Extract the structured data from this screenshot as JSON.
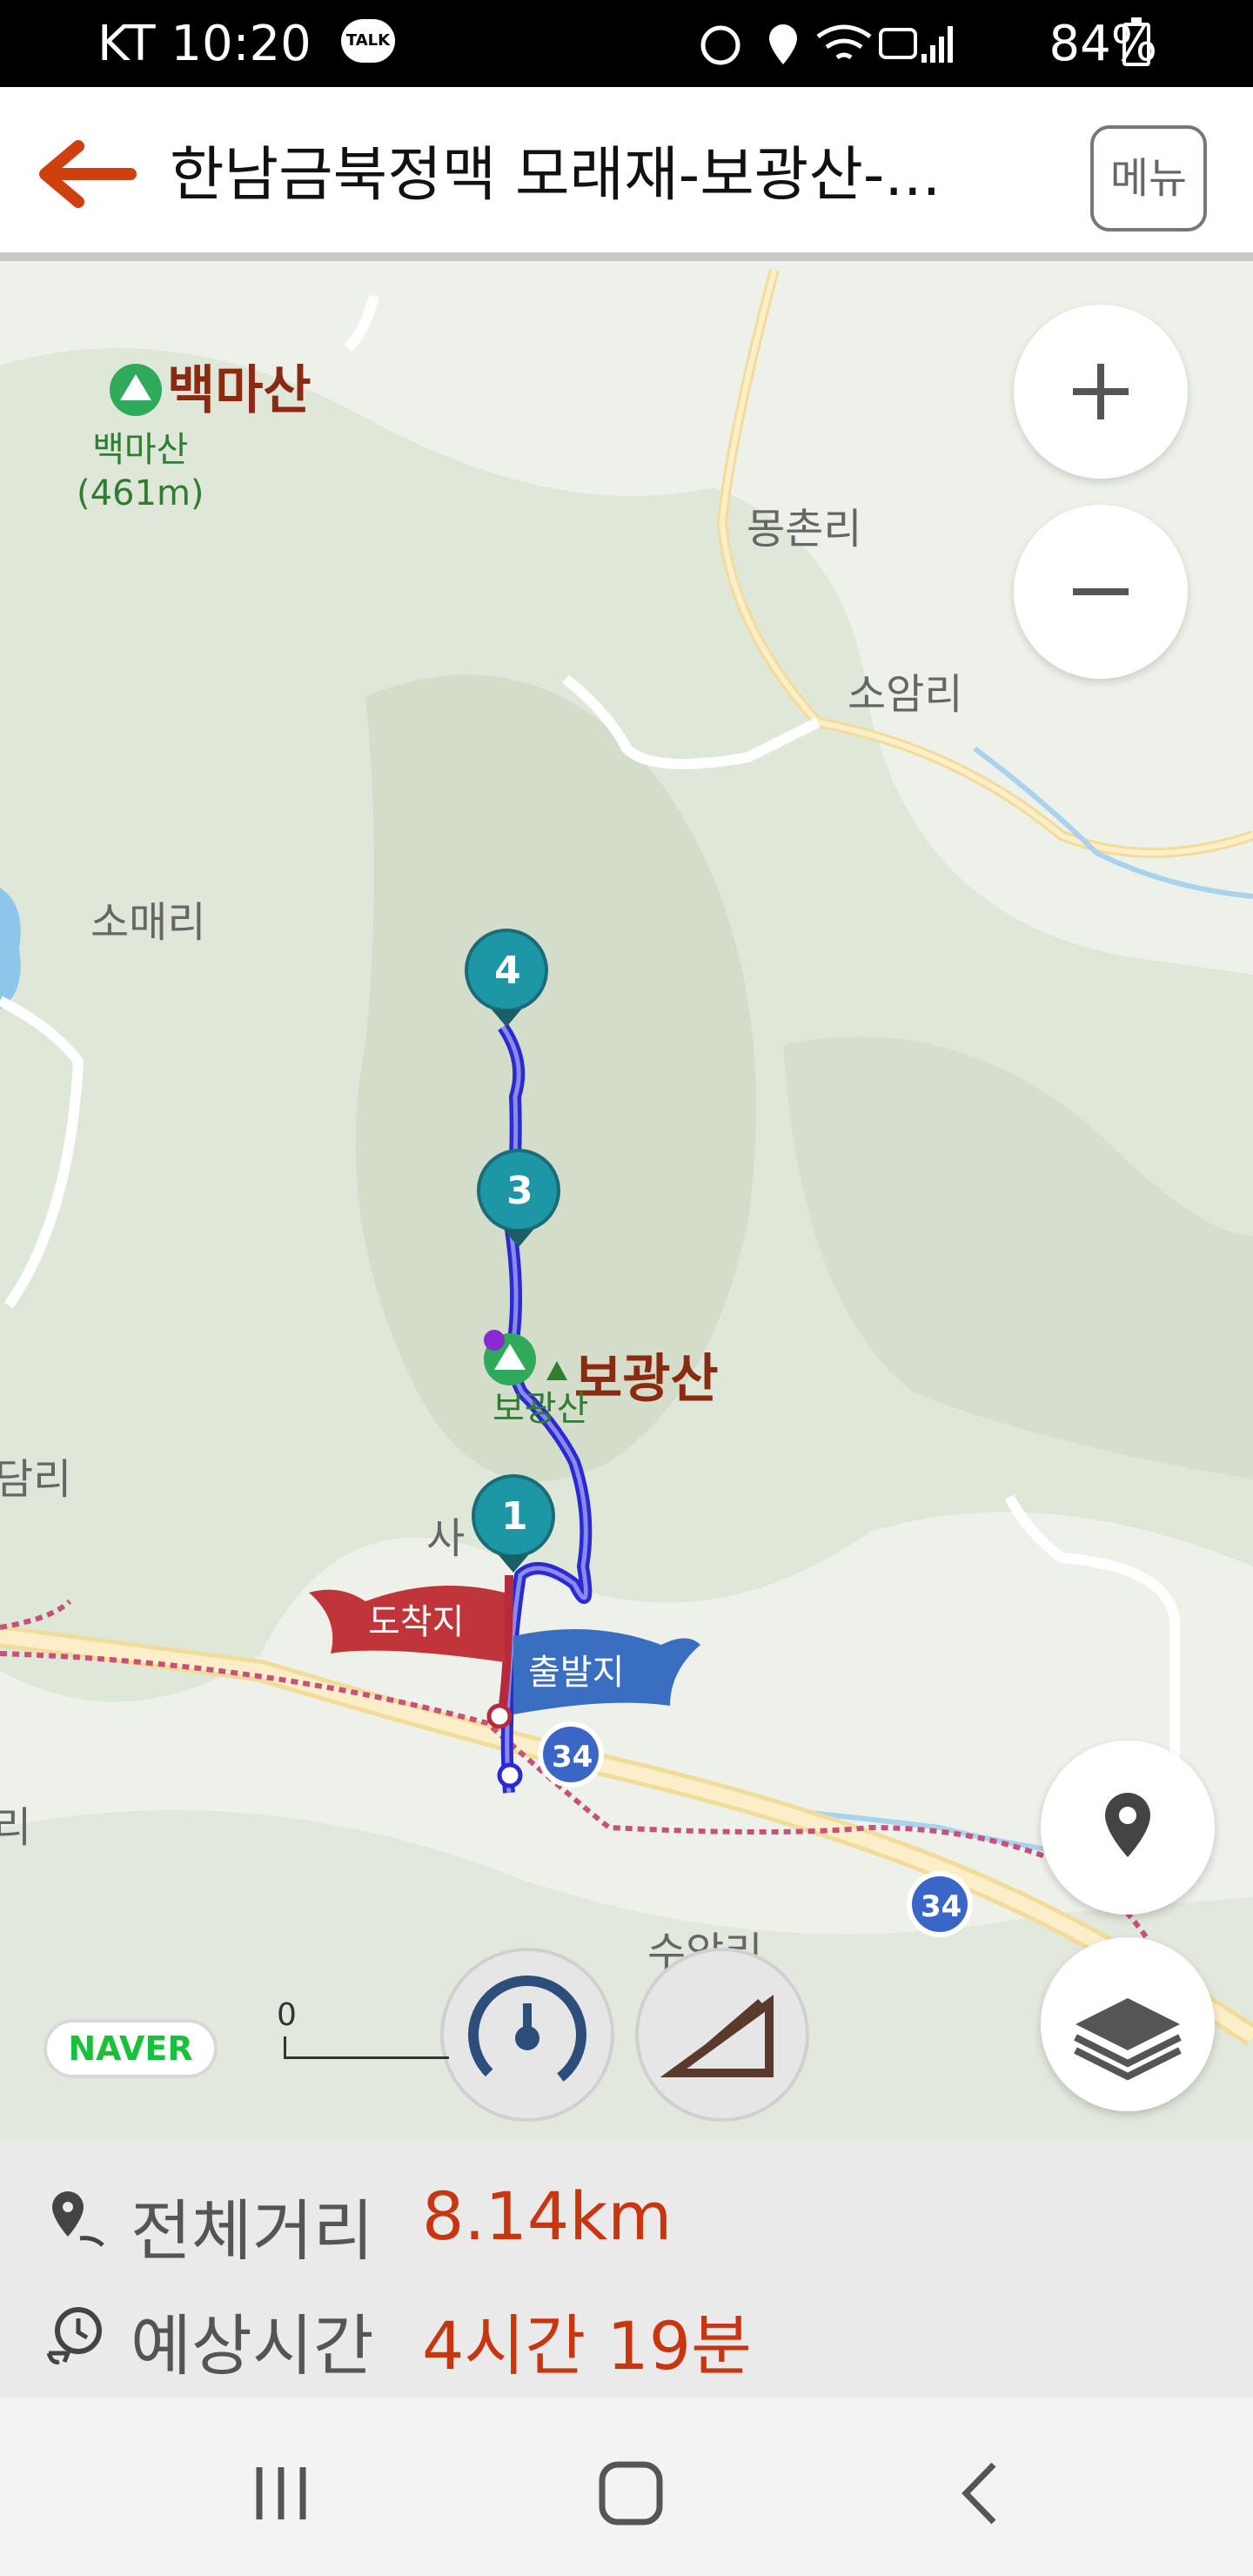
{
  "status_bar": {
    "carrier_time": "KT 10:20",
    "talk_badge": "TALK",
    "battery": "84%"
  },
  "header": {
    "title": "한남금북정맥 모래재-보광산-...",
    "menu_label": "메뉴"
  },
  "map": {
    "villages": [
      "몽촌리",
      "소암리",
      "소매리",
      "담리",
      "사",
      "리",
      "수암리"
    ],
    "mountains": [
      {
        "name": "백마산",
        "sub_name": "백마산",
        "elevation": "(461m)"
      },
      {
        "name": "보광산",
        "sub_name": "보광산"
      }
    ],
    "waypoints": [
      "1",
      "3",
      "4"
    ],
    "flags": {
      "arrival": "도착지",
      "departure": "출발지"
    },
    "route_shields": [
      "34",
      "34"
    ],
    "brand": "NAVER",
    "scale_zero": "0",
    "colors": {
      "route": "#2a2ad0",
      "arrival_flag": "#c0353a",
      "departure_flag": "#3a6ec0",
      "waypoint": "#1d97a6",
      "accent": "#c8350e"
    }
  },
  "summary": {
    "distance_label": "전체거리",
    "distance_value": "8.14km",
    "time_label": "예상시간",
    "time_value": "4시간 19분"
  },
  "icons": [
    "back-arrow-icon",
    "zoom-in-icon",
    "zoom-out-icon",
    "location-pin-icon",
    "layers-icon",
    "speedometer-icon",
    "elevation-icon",
    "distance-pin-icon",
    "clock-icon",
    "recent-apps-icon",
    "home-icon",
    "back-icon"
  ]
}
